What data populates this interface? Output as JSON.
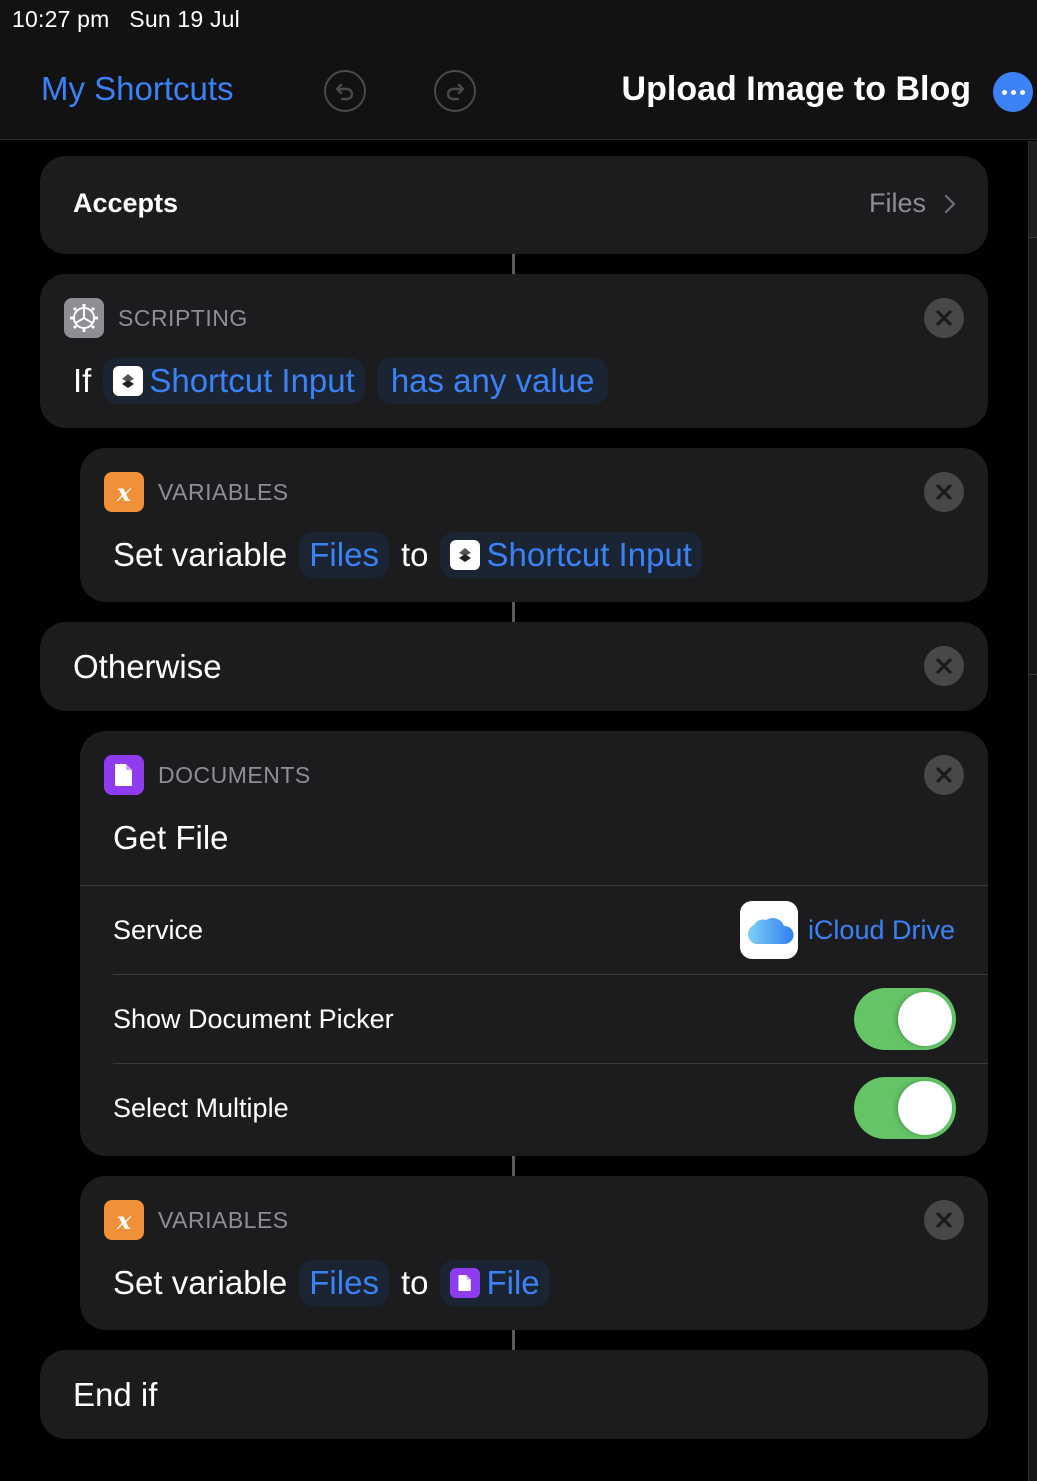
{
  "status_bar": {
    "time": "10:27 pm",
    "date": "Sun 19 Jul"
  },
  "nav": {
    "back_label": "My Shortcuts",
    "undo_icon": "undo-icon",
    "redo_icon": "redo-icon",
    "title": "Upload Image to Blog",
    "more_icon": "ellipsis-icon"
  },
  "colors": {
    "accent": "#3b82f6",
    "scripting": "#8e8e93",
    "variables": "#f0913a",
    "documents": "#8f3cf0",
    "toggle_on": "#64c466",
    "card_bg": "#1c1c1e"
  },
  "accepts": {
    "label": "Accepts",
    "value": "Files",
    "chevron_icon": "chevron-right-icon"
  },
  "actions": {
    "if": {
      "category": "SCRIPTING",
      "icon": "gear-icon",
      "keyword": "If",
      "input_token": "Shortcut Input",
      "condition_token": "has any value"
    },
    "set_var_1": {
      "category": "VARIABLES",
      "icon": "variable-x-icon",
      "verb": "Set variable",
      "variable_token": "Files",
      "to": "to",
      "value_token": "Shortcut Input"
    },
    "otherwise": {
      "label": "Otherwise"
    },
    "get_file": {
      "category": "DOCUMENTS",
      "icon": "document-icon",
      "title": "Get File",
      "params": [
        {
          "label": "Service",
          "value": "iCloud Drive",
          "icon": "icloud-icon"
        },
        {
          "label": "Show Document Picker",
          "toggle": true
        },
        {
          "label": "Select Multiple",
          "toggle": true
        }
      ]
    },
    "set_var_2": {
      "category": "VARIABLES",
      "icon": "variable-x-icon",
      "verb": "Set variable",
      "variable_token": "Files",
      "to": "to",
      "value_token": "File"
    },
    "end_if": {
      "label": "End if"
    }
  }
}
